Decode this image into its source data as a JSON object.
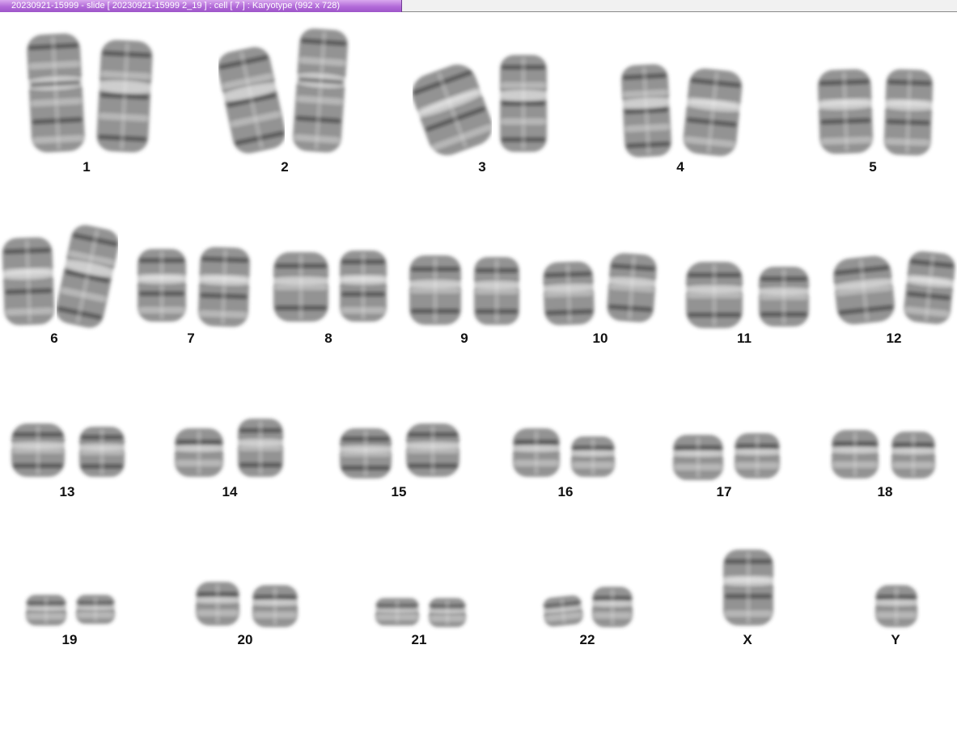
{
  "window": {
    "title": "20230921-15999 - slide [ 20230921-15999 2_19 ] : cell [ 7 ] : Karyotype  (992 x 728)"
  },
  "karyotype": {
    "labels": [
      "1",
      "2",
      "3",
      "4",
      "5",
      "6",
      "7",
      "8",
      "9",
      "10",
      "11",
      "12",
      "13",
      "14",
      "15",
      "16",
      "17",
      "18",
      "19",
      "20",
      "21",
      "22",
      "X",
      "Y"
    ]
  },
  "colors": {
    "title_tab": "#b26ad8",
    "chromosome": "#3a3a3a",
    "label": "#111111",
    "background": "#ffffff"
  }
}
